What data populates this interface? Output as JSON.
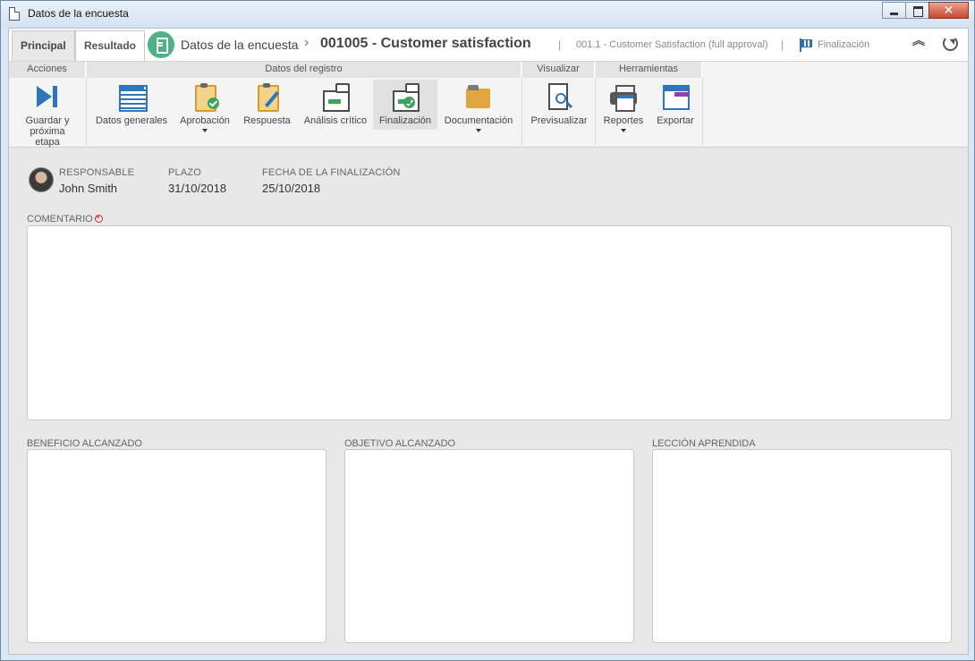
{
  "window": {
    "title": "Datos de la encuesta",
    "close_glyph": "✕"
  },
  "header": {
    "tabs": [
      {
        "label": "Principal"
      },
      {
        "label": "Resultado"
      }
    ],
    "breadcrumb": "Datos de la encuesta",
    "separator": "›",
    "record_title": "001005 - Customer satisfaction",
    "pipe": "|",
    "survey_name": "001.1 - Customer Satisfaction (full approval)",
    "stage": "Finalización",
    "collapse_glyph": "︽"
  },
  "ribbon": {
    "groups": [
      {
        "label": "Acciones"
      },
      {
        "label": "Datos del registro"
      },
      {
        "label": "Visualizar"
      },
      {
        "label": "Herramientas"
      }
    ],
    "buttons": [
      {
        "label": "Guardar y próxima etapa",
        "icon": "next-stage-icon"
      },
      {
        "label": "Datos generales",
        "icon": "form-icon"
      },
      {
        "label": "Aprobación",
        "icon": "approval-icon"
      },
      {
        "label": "Respuesta",
        "icon": "answer-icon"
      },
      {
        "label": "Análisis crítico",
        "icon": "critical-analysis-icon"
      },
      {
        "label": "Finalización",
        "icon": "completion-icon",
        "selected": true
      },
      {
        "label": "Documentación",
        "icon": "documentation-icon"
      },
      {
        "label": "Previsualizar",
        "icon": "preview-icon"
      },
      {
        "label": "Reportes",
        "icon": "printer-icon"
      },
      {
        "label": "Exportar",
        "icon": "export-icon"
      }
    ]
  },
  "info": {
    "responsible_label": "RESPONSABLE",
    "responsible_value": "John Smith",
    "deadline_label": "PLAZO",
    "deadline_value": "31/10/2018",
    "completion_label": "FECHA DE LA FINALIZACIÓN",
    "completion_value": "25/10/2018"
  },
  "fields": {
    "comment_label": "COMENTARIO",
    "comment_value": "",
    "benefit_label": "BENEFICIO ALCANZADO",
    "benefit_value": "",
    "objective_label": "OBJETIVO ALCANZADO",
    "objective_value": "",
    "lesson_label": "LECCIÓN APRENDIDA",
    "lesson_value": ""
  },
  "colors": {
    "accent_blue": "#2f74c0",
    "badge_green": "#4fb184",
    "required_red": "#d03030"
  }
}
